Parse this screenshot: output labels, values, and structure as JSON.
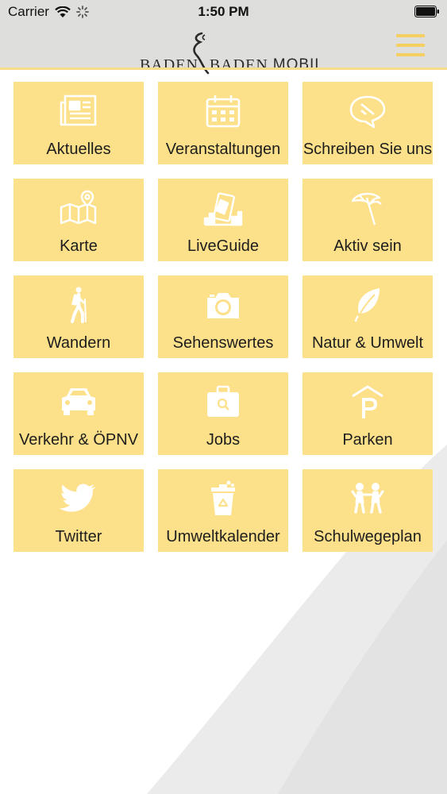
{
  "status_bar": {
    "carrier": "Carrier",
    "time": "1:50 PM"
  },
  "header": {
    "logo_left": "BADEN",
    "logo_right": "BADEN",
    "logo_suffix": "MOBIL"
  },
  "colors": {
    "tile": "#fde08a",
    "header": "#dededc",
    "accent": "#f5cf60",
    "icon": "#ffffff"
  },
  "tiles": [
    {
      "label": "Aktuelles",
      "icon": "newspaper-icon"
    },
    {
      "label": "Veranstaltungen",
      "icon": "calendar-icon"
    },
    {
      "label": "Schreiben Sie uns",
      "icon": "chat-bubble-icon"
    },
    {
      "label": "Karte",
      "icon": "map-icon"
    },
    {
      "label": "LiveGuide",
      "icon": "live-guide-icon"
    },
    {
      "label": "Aktiv sein",
      "icon": "parasol-icon"
    },
    {
      "label": "Wandern",
      "icon": "hiker-icon"
    },
    {
      "label": "Sehenswertes",
      "icon": "camera-icon"
    },
    {
      "label": "Natur & Umwelt",
      "icon": "leaf-icon"
    },
    {
      "label": "Verkehr & ÖPNV",
      "icon": "car-icon"
    },
    {
      "label": "Jobs",
      "icon": "briefcase-icon"
    },
    {
      "label": "Parken",
      "icon": "parking-icon"
    },
    {
      "label": "Twitter",
      "icon": "twitter-bird-icon"
    },
    {
      "label": "Umweltkalender",
      "icon": "recycle-bin-icon"
    },
    {
      "label": "Schulwegeplan",
      "icon": "children-icon"
    }
  ]
}
